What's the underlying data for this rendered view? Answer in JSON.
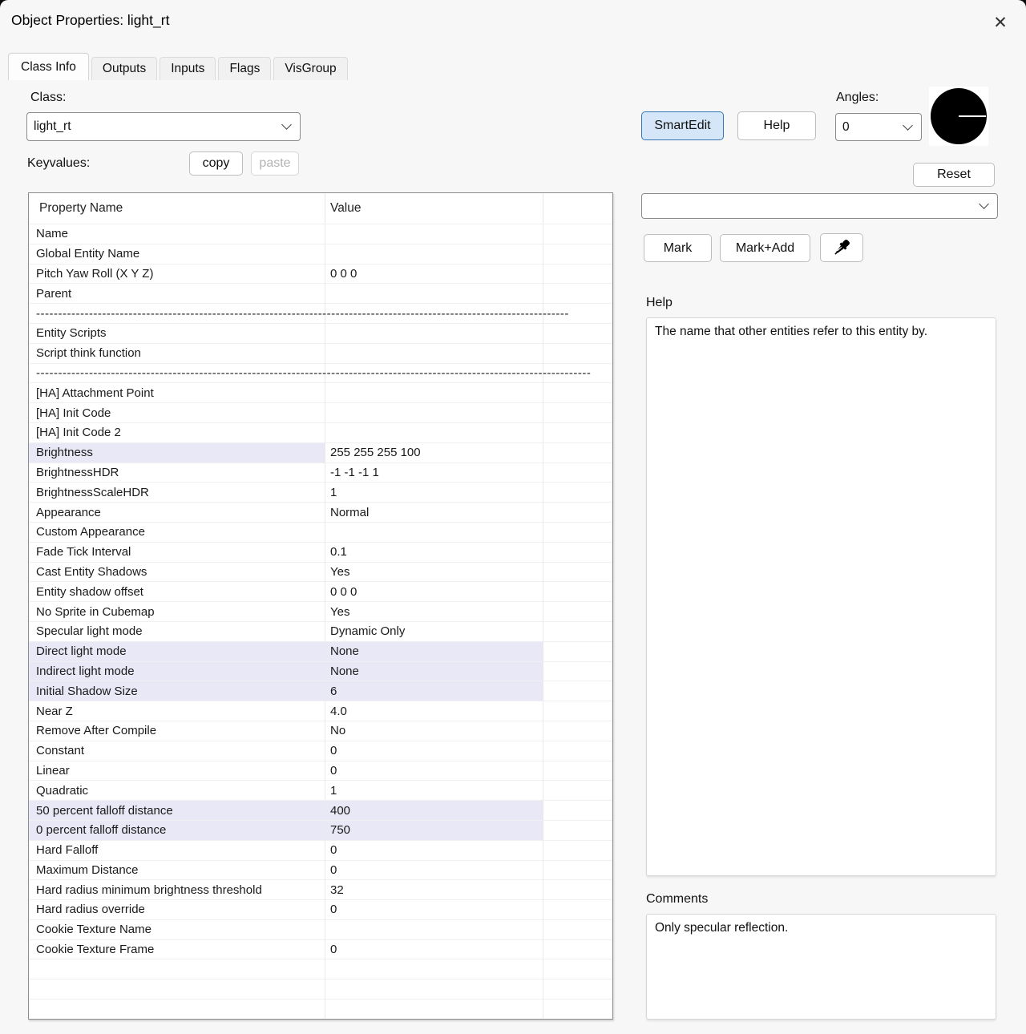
{
  "window": {
    "title": "Object Properties: light_rt"
  },
  "icons": {
    "close": "✕"
  },
  "tabs": [
    {
      "label": "Class Info",
      "active": true
    },
    {
      "label": "Outputs",
      "active": false
    },
    {
      "label": "Inputs",
      "active": false
    },
    {
      "label": "Flags",
      "active": false
    },
    {
      "label": "VisGroup",
      "active": false
    }
  ],
  "class_section": {
    "label": "Class:",
    "value": "light_rt",
    "keyvalues_label": "Keyvalues:",
    "copy_label": "copy",
    "paste_label": "paste"
  },
  "toolbar": {
    "smartedit_label": "SmartEdit",
    "help_label": "Help",
    "reset_label": "Reset",
    "mark_label": "Mark",
    "mark_add_label": "Mark+Add"
  },
  "angles": {
    "label": "Angles:",
    "value": "0"
  },
  "keyvalue_combo": {
    "value": ""
  },
  "property_table": {
    "headers": [
      "Property Name",
      "Value"
    ],
    "rows": [
      {
        "name": "Name",
        "value": "",
        "hl": "none"
      },
      {
        "name": "Global Entity Name",
        "value": "",
        "hl": "none"
      },
      {
        "name": "Pitch Yaw Roll (X Y Z)",
        "value": "0 0 0",
        "hl": "none"
      },
      {
        "name": "Parent",
        "value": "",
        "hl": "none"
      },
      {
        "name": "-------------------------------------------------------------------------------------------------------------------------",
        "value": "",
        "hl": "none",
        "type": "separator"
      },
      {
        "name": "Entity Scripts",
        "value": "",
        "hl": "none"
      },
      {
        "name": "Script think function",
        "value": "",
        "hl": "none"
      },
      {
        "name": "------------------------------------------------------------------------------------------------------------------------------",
        "value": "",
        "hl": "none",
        "type": "separator"
      },
      {
        "name": "[HA] Attachment Point",
        "value": "",
        "hl": "none"
      },
      {
        "name": "[HA] Init Code",
        "value": "",
        "hl": "none"
      },
      {
        "name": "[HA] Init Code 2",
        "value": "",
        "hl": "none"
      },
      {
        "name": "Brightness",
        "value": "255 255 255 100",
        "hl": "name"
      },
      {
        "name": "BrightnessHDR",
        "value": "-1 -1 -1 1",
        "hl": "none"
      },
      {
        "name": "BrightnessScaleHDR",
        "value": "1",
        "hl": "none"
      },
      {
        "name": "Appearance",
        "value": "Normal",
        "hl": "none"
      },
      {
        "name": "Custom Appearance",
        "value": "",
        "hl": "none"
      },
      {
        "name": "Fade Tick Interval",
        "value": "0.1",
        "hl": "none"
      },
      {
        "name": "Cast Entity Shadows",
        "value": "Yes",
        "hl": "none"
      },
      {
        "name": "Entity shadow offset",
        "value": "0 0 0",
        "hl": "none"
      },
      {
        "name": "No Sprite in Cubemap",
        "value": "Yes",
        "hl": "none"
      },
      {
        "name": "Specular light mode",
        "value": "Dynamic Only",
        "hl": "none"
      },
      {
        "name": "Direct light mode",
        "value": "None",
        "hl": "row"
      },
      {
        "name": "Indirect light mode",
        "value": "None",
        "hl": "row"
      },
      {
        "name": "Initial Shadow Size",
        "value": "6",
        "hl": "row"
      },
      {
        "name": "Near Z",
        "value": "4.0",
        "hl": "none"
      },
      {
        "name": "Remove After Compile",
        "value": "No",
        "hl": "none"
      },
      {
        "name": "Constant",
        "value": "0",
        "hl": "none"
      },
      {
        "name": "Linear",
        "value": "0",
        "hl": "none"
      },
      {
        "name": "Quadratic",
        "value": "1",
        "hl": "none"
      },
      {
        "name": "50 percent falloff distance",
        "value": "400",
        "hl": "row"
      },
      {
        "name": "0 percent falloff distance",
        "value": "750",
        "hl": "row"
      },
      {
        "name": "Hard Falloff",
        "value": "0",
        "hl": "none"
      },
      {
        "name": "Maximum Distance",
        "value": "0",
        "hl": "none"
      },
      {
        "name": "Hard radius minimum brightness threshold",
        "value": "32",
        "hl": "none"
      },
      {
        "name": "Hard radius override",
        "value": "0",
        "hl": "none"
      },
      {
        "name": "Cookie Texture Name",
        "value": "",
        "hl": "none"
      },
      {
        "name": "Cookie Texture Frame",
        "value": "0",
        "hl": "none"
      },
      {
        "name": "",
        "value": "",
        "hl": "none"
      },
      {
        "name": "",
        "value": "",
        "hl": "none"
      },
      {
        "name": "",
        "value": "",
        "hl": "none"
      }
    ]
  },
  "help_panel": {
    "label": "Help",
    "text": "The name that other entities refer to this entity by."
  },
  "comments_panel": {
    "label": "Comments",
    "text": "Only specular reflection."
  },
  "colors": {
    "highlight_row": "#e8e8f7",
    "smartedit_bg": "#d4e6f8",
    "smartedit_border": "#3875b5",
    "window_bg": "#f7f7f7"
  }
}
